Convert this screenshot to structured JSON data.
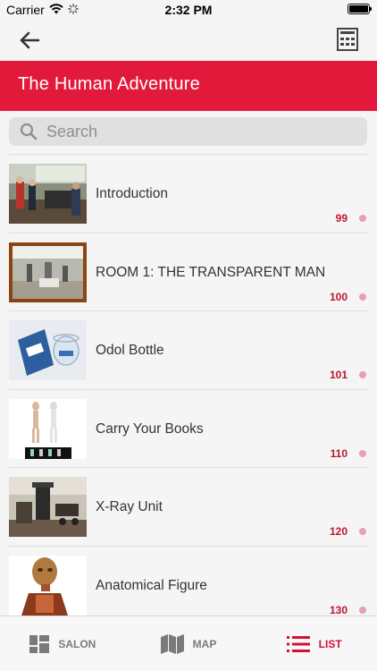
{
  "status_bar": {
    "carrier": "Carrier",
    "time": "2:32 PM"
  },
  "header": {
    "title": "The Human Adventure"
  },
  "search": {
    "placeholder": "Search"
  },
  "items": [
    {
      "title": "Introduction",
      "number": "99"
    },
    {
      "title": "ROOM 1: THE TRANSPARENT MAN",
      "number": "100"
    },
    {
      "title": "Odol Bottle",
      "number": "101"
    },
    {
      "title": "Carry Your Books",
      "number": "110"
    },
    {
      "title": "X-Ray Unit",
      "number": "120"
    },
    {
      "title": "Anatomical Figure",
      "number": "130"
    }
  ],
  "tabs": [
    {
      "label": "SALON",
      "icon": "grid-icon"
    },
    {
      "label": "MAP",
      "icon": "map-icon"
    },
    {
      "label": "LIST",
      "icon": "list-icon",
      "active": true
    }
  ],
  "colors": {
    "accent": "#e2193a",
    "number": "#c0142f",
    "dot": "#e6a2ad"
  }
}
